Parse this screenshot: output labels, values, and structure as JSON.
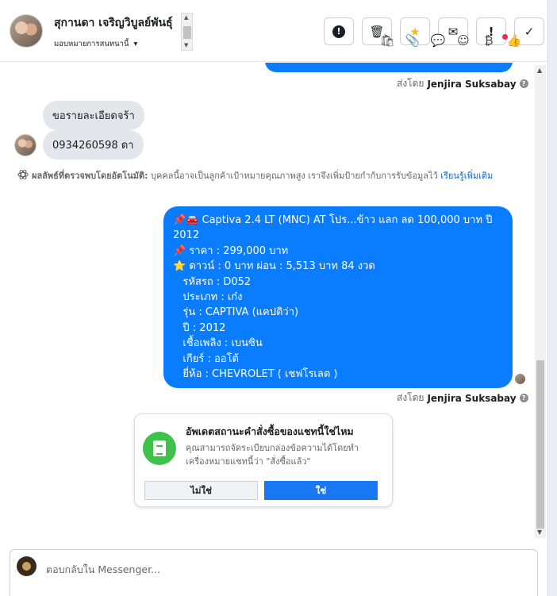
{
  "header": {
    "contact_name": "สุกานดา เจริญวิบูลย์พันธุ์",
    "assign_label": "มอบหมายการสนทนานี้",
    "actions": [
      {
        "name": "spam-button",
        "symbol": "!"
      },
      {
        "name": "delete-button",
        "symbol": "🗑"
      },
      {
        "name": "star-button",
        "symbol": "★"
      },
      {
        "name": "mark-unread-button",
        "symbol": "✉"
      },
      {
        "name": "follow-up-button",
        "symbol": "!"
      },
      {
        "name": "mark-done-button",
        "symbol": "✓"
      }
    ]
  },
  "conversation": {
    "sent_by_prefix": "ส่งโดย",
    "sent_by_name": "Jenjira Suksabay",
    "incoming": [
      "ขอรายละเอียดจร้า",
      "0934260598 ดา"
    ],
    "auto_note": {
      "bold": "ผลลัพธ์ที่ตรวจพบโดยอัตโนมัติ:",
      "text": "บุคคลนี้อาจเป็นลูกค้าเป้าหมายคุณภาพสูง เราจึงเพิ่มป้ายกำกับการรับข้อมูลไว้",
      "link": "เรียนรู้เพิ่มเติม"
    },
    "outgoing_lines": [
      "📌🚘 Captiva 2.4 LT (MNC) AT โปร...ข้าว แลก ลด 100,000 บาท ปี 2012",
      "📌 ราคา : 299,000 บาท",
      "⭐ ดาวน์ : 0 บาท ผ่อน : 5,513 บาท 84 งวด",
      "   รหัสรถ : D052",
      "   ประเภท : เก๋ง",
      "   รุ่น : CAPTIVA (แคปติว่า)",
      "   ปี : 2012",
      "   เชื้อเพลิง : เบนซิน",
      "   เกียร์ : ออโต้",
      "   ยี่ห้อ : CHEVROLET ( เชฟโรเลต )"
    ]
  },
  "card": {
    "title": "อัพเดตสถานะคำสั่งซื้อของแชทนี้ใช่ไหม",
    "description": "คุณสามารถจัดระเบียบกล่องข้อความได้โดยทำเครื่องหมายแชทนี้ว่า \"สั่งซื้อแล้ว\"",
    "no_label": "ไม่ใช่",
    "yes_label": "ใช่"
  },
  "composer": {
    "placeholder": "ตอบกลับใน Messenger..."
  },
  "colors": {
    "accent": "#0a7cff",
    "button_blue": "#1877f2",
    "card_icon_green": "#3ec24a"
  }
}
